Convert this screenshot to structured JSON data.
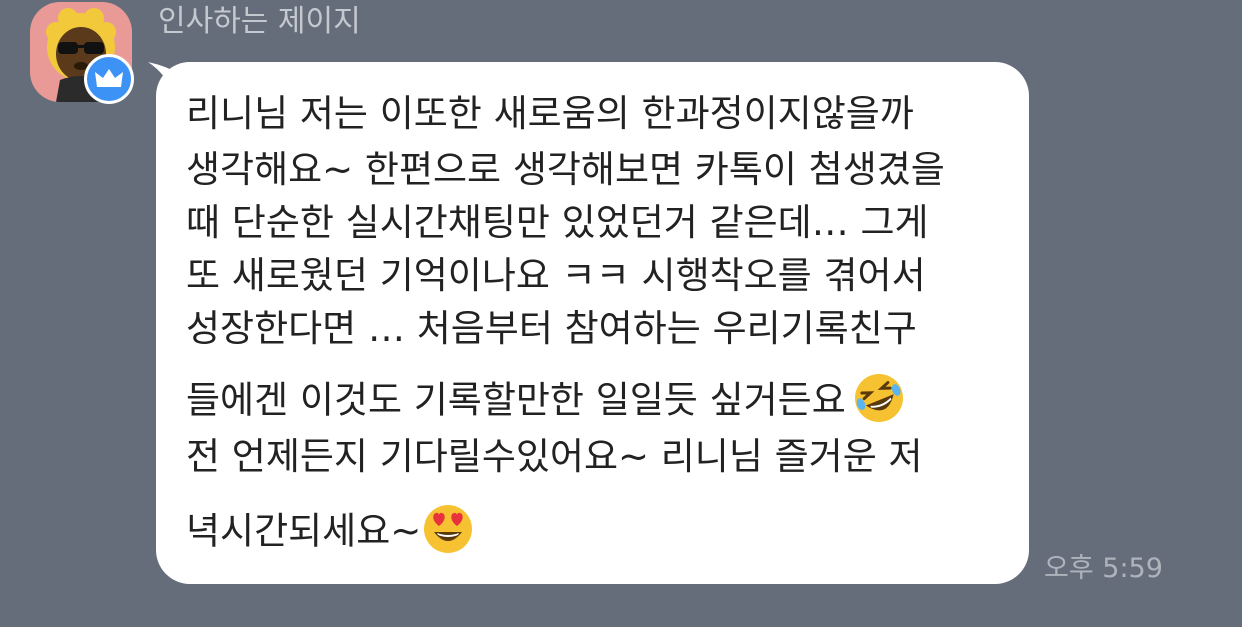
{
  "chat": {
    "sender_name": "인사하는 제이지",
    "timestamp": "오후 5:59",
    "message_lines": [
      "리니님 저는 이또한 새로움의 한과정이지않을까",
      "생각해요~ 한편으로 생각해보면 카톡이 첨생겼을",
      "때 단순한 실시간채팅만 있었던거 같은데… 그게",
      "또 새로웠던 기억이나요 ㅋㅋ 시행착오를 겪어서",
      "성장한다면 … 처음부터 참여하는 우리기록친구",
      "들에겐 이것도 기록할만한 일일듯 싶거든요",
      "전 언제든지 기다릴수있어요~ 리니님 즐거운 저",
      "녁시간되세요~"
    ],
    "avatar": {
      "icon": "jay-g-character-icon",
      "badge_icon": "crown-icon",
      "background": "#e99a96",
      "badge_color": "#3d93f5"
    },
    "emojis": [
      "rolling-on-floor-laughing-emoji",
      "heart-eyes-emoji"
    ],
    "colors": {
      "background": "#666d7a",
      "bubble": "#ffffff",
      "text": "#222222"
    }
  }
}
